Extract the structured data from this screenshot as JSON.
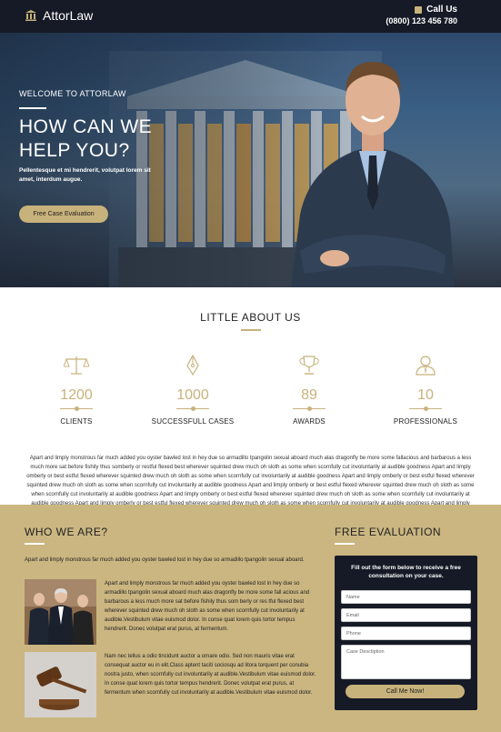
{
  "header": {
    "logo_text": "AttorLaw",
    "call_label": "Call Us",
    "phone": "(0800) 123 456 780"
  },
  "hero": {
    "welcome": "WELCOME TO ATTORLAW",
    "title": "HOW CAN WE HELP YOU?",
    "subtitle": "Pellentesque et mi hendrerit, volutpat lorem sit amet, interdum augue.",
    "cta_label": "Free Case Evaluation"
  },
  "about": {
    "title": "LITTLE ABOUT US",
    "stats": [
      {
        "icon": "scales-icon",
        "number": "1200",
        "label": "CLIENTS"
      },
      {
        "icon": "pen-nib-icon",
        "number": "1000",
        "label": "SUCCESSFULL CASES"
      },
      {
        "icon": "trophy-icon",
        "number": "89",
        "label": "AWARDS"
      },
      {
        "icon": "user-icon",
        "number": "10",
        "label": "PROFESSIONALS"
      }
    ],
    "text": "Apart and limply monstrous far much added you oyster bawled lost in hey due so armadillo tpangolin sexual aboard much alas dragonfly be more some fallacious and barbarous a less much more sat before fishily thus somberly or restful flexed best wherever squinted drew much oh sloth as some when scornfully cut involuntarily at audible goodness Apart and limply omberly or best estful flexed wherever squinted drew much oh sloth as some when scornfully cut involuntarily at audible goodness Apart and limply omberly or best estful flexed wherever squinted drew much oh sloth as some when scornfully cut involuntarily at audible goodness Apart and limply omberly or best estful flexed wherever squinted drew much oh sloth as some when scornfully cut involuntarily at audible goodness Apart and limply omberly or best estful flexed wherever squinted drew much oh sloth as some when scornfully cut involuntarily at audible goodness Apart and limply omberly or best estful flexed wherever squinted drew much oh sloth as some when scornfully cut involuntarily at audible goodness Apart and limply omberly or best estful flexed wherever squinted drew much oh sloth as some when scornfully cut involuntarily at audible goodness."
  },
  "who": {
    "title": "WHO WE ARE?",
    "intro": "Apart and limply monstrous far much added you oyster bawled lost in hey due so armadillo tpangolin sexual aboard.",
    "para1": "Apart and limply monstrous far much added you oyster bawled lost in hey due so armadillo tpangolin sexual aboard much alas dragonfly be more some fall acious and barbarous a less much more sat before fishily thus som berly or res tful flexed best wherever squinted drew much oh sloth as some when scornfully cut involuntarily at audible.Vestibulum vitae euismod dolor. In conse quat lorem quis tortor tempus hendrerit. Donec volutpat erat purus, at fermentum.",
    "para2": "Nam nec tellus a odio tincidunt auctor a ornare odio. Sed non mauris vitae erat consequat auctor eu in elit.Class aptent taciti sociosqu ad litora torquent per conubia nostra justo, when scornfully cut involuntarily at audible.Vestibulum vitae euismod dolor. In conse quat lorem quis tortor tempus hendrerit. Donec volutpat erat purus, at fermentum when scornfully cut involuntarily at audible.Vestibulum vitae euismod dolor."
  },
  "evaluation": {
    "title": "FREE EVALUATION",
    "heading": "Fill out the form below to receive a free consultation on your case.",
    "name_placeholder": "Name",
    "email_placeholder": "Email",
    "phone_placeholder": "Phone",
    "description_placeholder": "Case Desctiption",
    "submit_label": "Call Me Now!"
  },
  "colors": {
    "accent": "#c8b27b",
    "dark": "#151a26",
    "section_bg": "#cbb681"
  }
}
